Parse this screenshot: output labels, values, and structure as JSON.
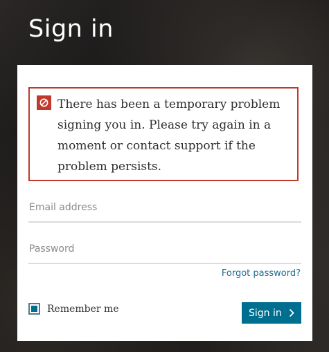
{
  "header": {
    "title": "Sign in"
  },
  "alert": {
    "icon": "block-icon",
    "color": "#c0392b",
    "message": "There has been a temporary problem signing you in. Please try again in a moment or contact support if the problem persists."
  },
  "form": {
    "email_placeholder": "Email address",
    "email_value": "",
    "password_placeholder": "Password",
    "password_value": "",
    "forgot_label": "Forgot password?",
    "remember_label": "Remember me",
    "remember_checked": true,
    "submit_label": "Sign in",
    "submit_icon": "chevron-right-icon",
    "accent_color": "#006f8f"
  }
}
